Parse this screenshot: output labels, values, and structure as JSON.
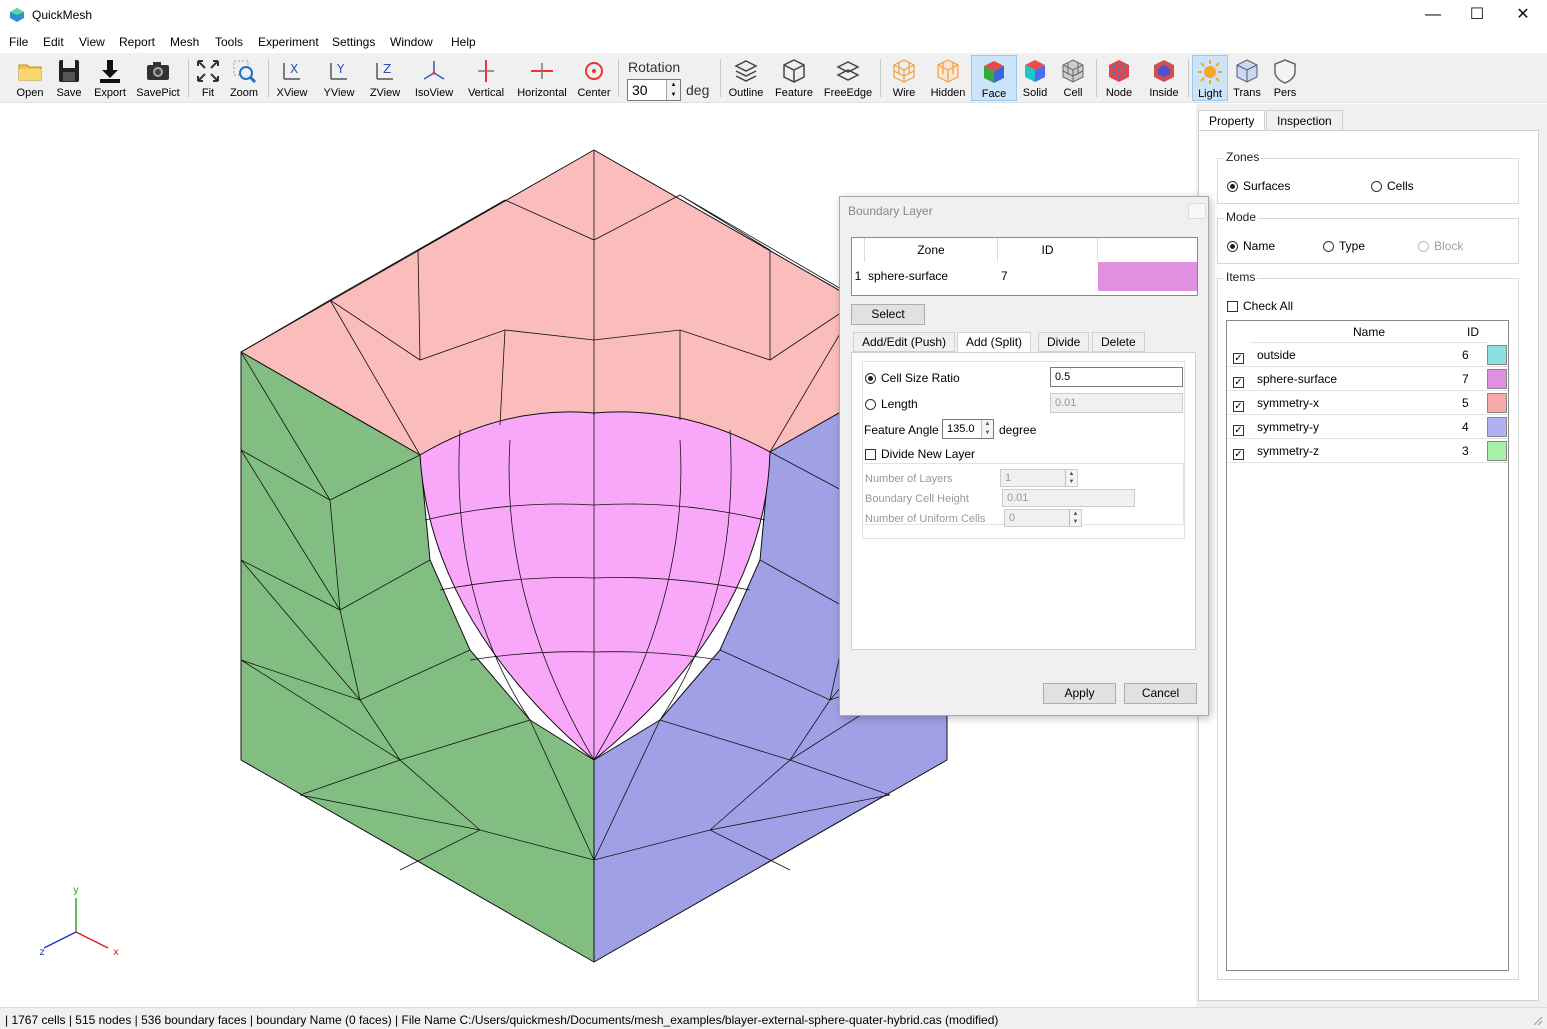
{
  "window": {
    "title": "QuickMesh",
    "minimize": "—",
    "maximize": "☐",
    "close": "✕"
  },
  "menu": [
    "File",
    "Edit",
    "View",
    "Report",
    "Mesh",
    "Tools",
    "Experiment",
    "Settings",
    "Window",
    "Help"
  ],
  "toolbar": {
    "buttons": [
      "Open",
      "Save",
      "Export",
      "SavePict",
      "Fit",
      "Zoom",
      "XView",
      "YView",
      "ZView",
      "IsoView",
      "Vertical",
      "Horizontal",
      "Center",
      "Outline",
      "Feature",
      "FreeEdge",
      "Wire",
      "Hidden",
      "Face",
      "Solid",
      "Cell",
      "Node",
      "Inside",
      "Light",
      "Trans",
      "Pers"
    ],
    "active": [
      "Face",
      "Light"
    ],
    "rotation_label": "Rotation",
    "rotation_value": "30",
    "rotation_unit": "deg"
  },
  "viewport": {
    "axes": {
      "x": "x",
      "y": "y",
      "z": "z"
    },
    "face_colors": {
      "top": "#fbbcbc",
      "left": "#82be82",
      "right": "#a0a0e6",
      "sphere": "#f9a8f9"
    }
  },
  "right_panel": {
    "tabs": [
      "Property",
      "Inspection"
    ],
    "active_tab": "Property",
    "zones": {
      "title": "Zones",
      "options": [
        "Surfaces",
        "Cells"
      ],
      "selected": "Surfaces"
    },
    "mode": {
      "title": "Mode",
      "options": [
        "Name",
        "Type",
        "Block"
      ],
      "selected": "Name",
      "disabled": [
        "Block"
      ]
    },
    "items": {
      "title": "Items",
      "check_all": "Check All",
      "columns": [
        "Name",
        "ID"
      ],
      "rows": [
        {
          "name": "outside",
          "id": "6",
          "color": "#8ee0e0",
          "checked": true
        },
        {
          "name": "sphere-surface",
          "id": "7",
          "color": "#e090e0",
          "checked": true
        },
        {
          "name": "symmetry-x",
          "id": "5",
          "color": "#f8a8a8",
          "checked": true
        },
        {
          "name": "symmetry-y",
          "id": "4",
          "color": "#b0b0f4",
          "checked": true
        },
        {
          "name": "symmetry-z",
          "id": "3",
          "color": "#a8f0a8",
          "checked": true
        }
      ]
    }
  },
  "dialog": {
    "title": "Boundary Layer",
    "zone_table": {
      "columns": [
        "Zone",
        "ID"
      ],
      "row_number": "1",
      "zone": "sphere-surface",
      "id": "7",
      "color": "#e090e0"
    },
    "select_button": "Select",
    "tabs": [
      "Add/Edit (Push)",
      "Add (Split)",
      "Divide",
      "Delete"
    ],
    "active_tab": "Add (Split)",
    "cell_size_ratio_label": "Cell Size Ratio",
    "cell_size_ratio_value": "0.5",
    "length_label": "Length",
    "length_value": "0.01",
    "feature_angle_label": "Feature Angle",
    "feature_angle_value": "135.0",
    "feature_angle_unit": "degree",
    "divide_new_layer_label": "Divide New Layer",
    "number_of_layers_label": "Number of Layers",
    "number_of_layers_value": "1",
    "boundary_cell_height_label": "Boundary Cell Height",
    "boundary_cell_height_value": "0.01",
    "number_of_uniform_cells_label": "Number of Uniform Cells",
    "number_of_uniform_cells_value": "0",
    "apply_button": "Apply",
    "cancel_button": "Cancel"
  },
  "status": {
    "text": "| 1767 cells | 515 nodes | 536 boundary faces |  boundary Name  (0 faces) | File Name C:/Users/quickmesh/Documents/mesh_examples/blayer-external-sphere-quater-hybrid.cas (modified)"
  }
}
